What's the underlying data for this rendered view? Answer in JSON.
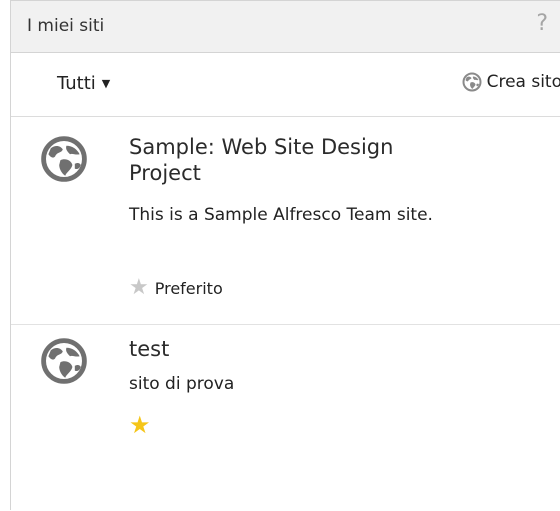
{
  "dashlet": {
    "title": "I miei siti",
    "help": "?"
  },
  "toolbar": {
    "filter_label": "Tutti",
    "filter_caret": "▼",
    "create_site_label": "Crea sito",
    "create_site_icon": "globe-icon"
  },
  "sites": [
    {
      "name": "Sample: Web Site Design Project",
      "description": "This is a Sample Alfresco Team site.",
      "favorite": false,
      "favorite_label": "Preferito",
      "icon": "globe-icon"
    },
    {
      "name": "test",
      "description": "sito di prova",
      "favorite": true,
      "favorite_label": "",
      "icon": "globe-icon"
    }
  ],
  "colors": {
    "title_bar_bg": "#f1f1f1",
    "favorite_star": "#f5c518",
    "unfavorite_star": "#c8c8c8"
  }
}
